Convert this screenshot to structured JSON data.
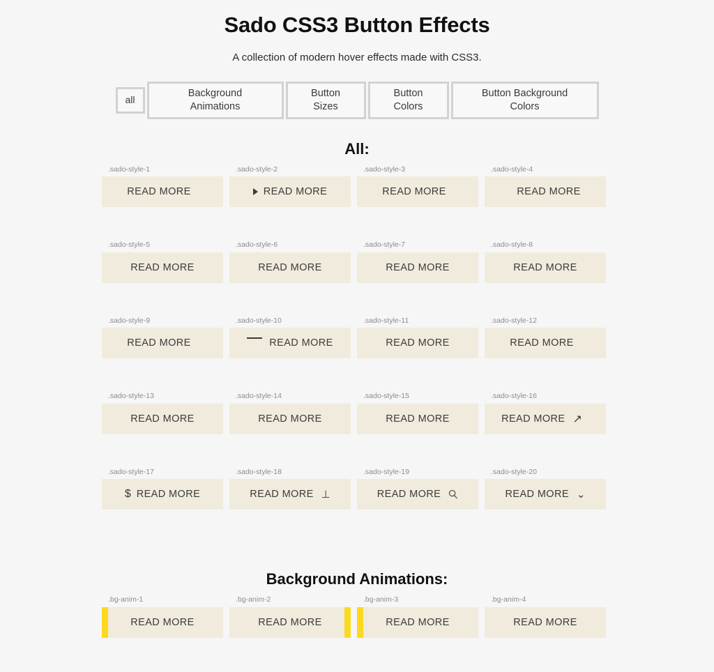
{
  "header": {
    "title": "Sado CSS3 Button Effects",
    "subtitle": "A collection of modern hover effects made with CSS3."
  },
  "filters": {
    "items": [
      {
        "label": "all",
        "key": "all",
        "active": true
      },
      {
        "label": "Background\nAnimations",
        "key": "background-animations",
        "active": false
      },
      {
        "label": "Button\nSizes",
        "key": "button-sizes",
        "active": false
      },
      {
        "label": "Button\nColors",
        "key": "button-colors",
        "active": false
      },
      {
        "label": "Button Background\nColors",
        "key": "button-background-colors",
        "active": false
      }
    ]
  },
  "sections": [
    {
      "heading": "All:",
      "rows": [
        [
          {
            "label": ".sado-style-1",
            "button_text": "READ MORE",
            "icon": null,
            "icon_pos": null,
            "align": "center"
          },
          {
            "label": ".sado-style-2",
            "button_text": "READ MORE",
            "icon": "play-icon",
            "icon_pos": "pre",
            "align": "center"
          },
          {
            "label": ".sado-style-3",
            "button_text": "READ MORE",
            "icon": null,
            "icon_pos": null,
            "align": "center"
          },
          {
            "label": ".sado-style-4",
            "button_text": "READ MORE",
            "icon": null,
            "icon_pos": null,
            "align": "center"
          }
        ],
        [
          {
            "label": ".sado-style-5",
            "button_text": "READ MORE",
            "icon": null,
            "icon_pos": null,
            "align": "center"
          },
          {
            "label": ".sado-style-6",
            "button_text": "READ MORE",
            "icon": null,
            "icon_pos": null,
            "align": "center"
          },
          {
            "label": ".sado-style-7",
            "button_text": "READ MORE",
            "icon": null,
            "icon_pos": null,
            "align": "center"
          },
          {
            "label": ".sado-style-8",
            "button_text": "READ MORE",
            "icon": null,
            "icon_pos": null,
            "align": "center"
          }
        ],
        [
          {
            "label": ".sado-style-9",
            "button_text": "READ MORE",
            "icon": null,
            "icon_pos": null,
            "align": "center"
          },
          {
            "label": ".sado-style-10",
            "button_text": "READ MORE",
            "icon": "dash-icon",
            "icon_pos": "pre",
            "align": "center"
          },
          {
            "label": ".sado-style-11",
            "button_text": "READ MORE",
            "icon": null,
            "icon_pos": null,
            "align": "center"
          },
          {
            "label": ".sado-style-12",
            "button_text": "READ MORE",
            "icon": null,
            "icon_pos": null,
            "align": "center"
          }
        ],
        [
          {
            "label": ".sado-style-13",
            "button_text": "READ MORE",
            "icon": null,
            "icon_pos": null,
            "align": "center"
          },
          {
            "label": ".sado-style-14",
            "button_text": "READ MORE",
            "icon": null,
            "icon_pos": null,
            "align": "center"
          },
          {
            "label": ".sado-style-15",
            "button_text": "READ MORE",
            "icon": null,
            "icon_pos": null,
            "align": "center"
          },
          {
            "label": ".sado-style-16",
            "button_text": "READ MORE",
            "icon": "arrow-ne-icon",
            "icon_pos": "post",
            "align": "center"
          }
        ],
        [
          {
            "label": ".sado-style-17",
            "button_text": "READ MORE",
            "icon": "dollar-icon",
            "icon_pos": "pre",
            "align": "center"
          },
          {
            "label": ".sado-style-18",
            "button_text": "READ MORE",
            "icon": "perpendicular-icon",
            "icon_pos": "post",
            "align": "center"
          },
          {
            "label": ".sado-style-19",
            "button_text": "READ MORE",
            "icon": "search-icon",
            "icon_pos": "post",
            "align": "center"
          },
          {
            "label": ".sado-style-20",
            "button_text": "READ MORE",
            "icon": "chevron-down-icon",
            "icon_pos": "post",
            "align": "center"
          }
        ]
      ]
    },
    {
      "heading": "Background Animations:",
      "rows": [
        [
          {
            "label": ".bg-anim-1",
            "button_text": "READ MORE",
            "icon": null,
            "icon_pos": null,
            "accent": "left",
            "align": "center"
          },
          {
            "label": ".bg-anim-2",
            "button_text": "READ MORE",
            "icon": null,
            "icon_pos": null,
            "accent": "right",
            "align": "center"
          },
          {
            "label": ".bg-anim-3",
            "button_text": "READ MORE",
            "icon": null,
            "icon_pos": null,
            "accent": "left",
            "align": "center"
          },
          {
            "label": ".bg-anim-4",
            "button_text": "READ MORE",
            "icon": null,
            "icon_pos": null,
            "accent": null,
            "align": "center"
          }
        ]
      ]
    }
  ],
  "colors": {
    "page_background": "#f6f6f6",
    "card_background": "#f0ebdc",
    "accent_yellow": "#fcd91e",
    "filter_border": "#d2d2d2",
    "text_primary": "#111111",
    "label_gray": "#8c8c8c"
  }
}
